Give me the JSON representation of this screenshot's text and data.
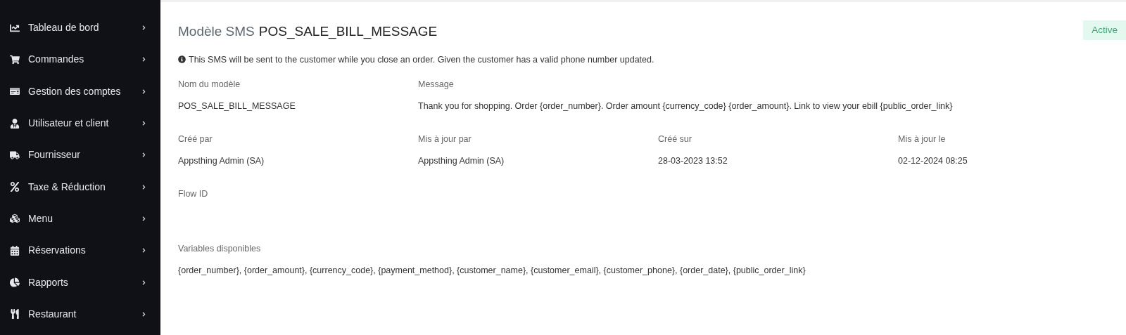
{
  "sidebar": {
    "items": [
      {
        "label": "Tableau de bord"
      },
      {
        "label": "Commandes"
      },
      {
        "label": "Gestion des comptes"
      },
      {
        "label": "Utilisateur et client"
      },
      {
        "label": "Fournisseur"
      },
      {
        "label": "Taxe & Réduction"
      },
      {
        "label": "Menu"
      },
      {
        "label": "Réservations"
      },
      {
        "label": "Rapports"
      },
      {
        "label": "Restaurant"
      }
    ]
  },
  "header": {
    "prefix": "Modèle SMS",
    "name": "POS_SALE_BILL_MESSAGE",
    "status": "Active"
  },
  "info": "This SMS will be sent to the customer while you close an order. Given the customer has a valid phone number updated.",
  "field_rows": [
    [
      {
        "label": "Nom du modèle",
        "value": "POS_SALE_BILL_MESSAGE"
      },
      {
        "label": "Message",
        "value": "Thank you for shopping. Order {order_number}. Order amount {currency_code} {order_amount}. Link to view your ebill {public_order_link}"
      }
    ],
    [
      {
        "label": "Créé par",
        "value": "Appsthing Admin (SA)"
      },
      {
        "label": "Mis à jour par",
        "value": "Appsthing Admin (SA)"
      },
      {
        "label": "Créé sur",
        "value": "28-03-2023 13:52"
      },
      {
        "label": "Mis à jour le",
        "value": "02-12-2024 08:25"
      }
    ],
    [
      {
        "label": "Flow ID"
      }
    ],
    [
      {
        "label": "Variables disponibles",
        "value": "{order_number}, {order_amount}, {currency_code}, {payment_method}, {customer_name}, {customer_email}, {customer_phone}, {order_date}, {public_order_link}"
      }
    ]
  ]
}
